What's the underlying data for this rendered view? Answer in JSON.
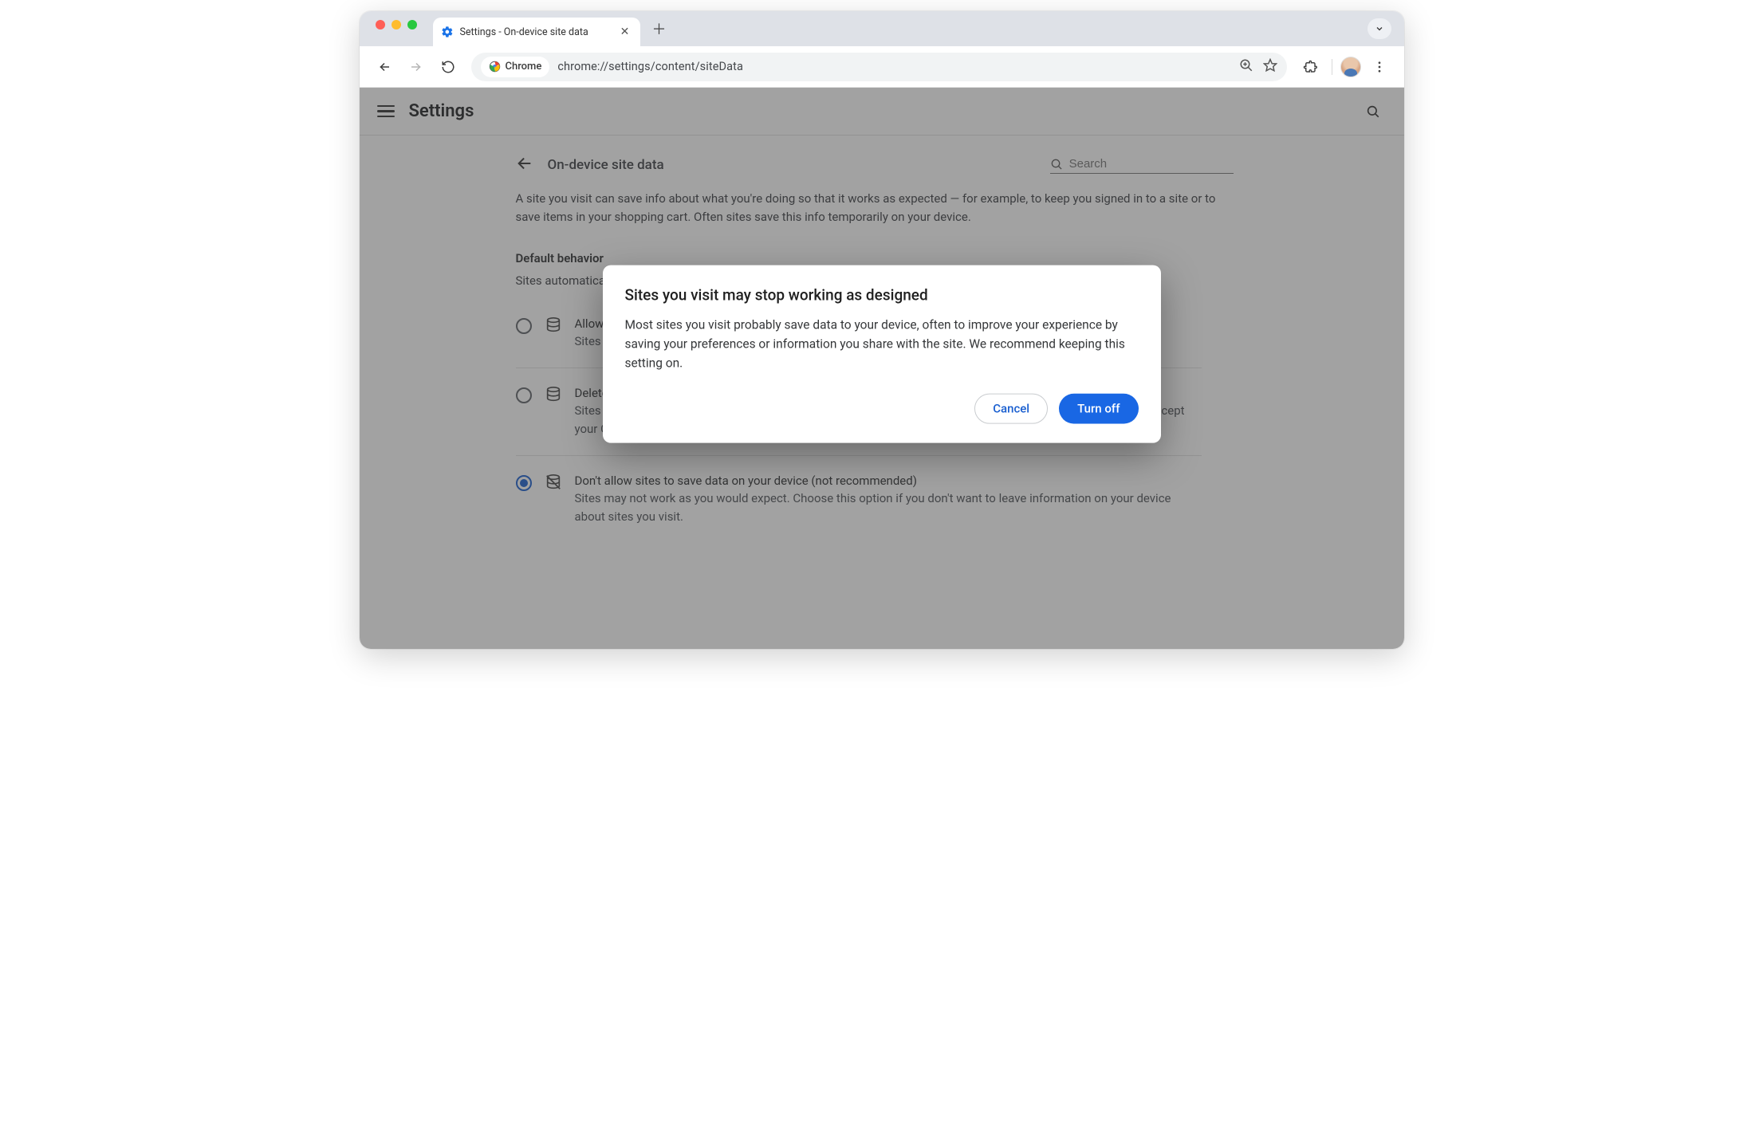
{
  "browser": {
    "tab_title": "Settings - On-device site data",
    "omnibox_chip": "Chrome",
    "url": "chrome://settings/content/siteData"
  },
  "header": {
    "title": "Settings"
  },
  "section": {
    "title": "On-device site data",
    "search_placeholder": "Search",
    "description": "A site you visit can save info about what you're doing so that it works as expected — for example, to keep you signed in to a site or to save items in your shopping cart. Often sites save this info temporarily on your device.",
    "default_heading": "Default behavior",
    "default_sub": "Sites automatically follow this setting when you visit them"
  },
  "options": [
    {
      "title": "Allow sites to save data on your device",
      "subtitle": "Sites will probably work as expected.",
      "selected": false,
      "strike": false
    },
    {
      "title": "Delete data sites have saved to your device when you close all windows",
      "subtitle": "Sites will probably work as expected. You'll be signed out of most sites when you close all Chrome windows, except your Google Account if you're signed in to Chrome.",
      "selected": false,
      "strike": false
    },
    {
      "title": "Don't allow sites to save data on your device (not recommended)",
      "subtitle": "Sites may not work as you would expect. Choose this option if you don't want to leave information on your device about sites you visit.",
      "selected": true,
      "strike": true
    }
  ],
  "dialog": {
    "title": "Sites you visit may stop working as designed",
    "body": "Most sites you visit probably save data to your device, often to improve your experience by saving your preferences or information you share with the site. We recommend keeping this setting on.",
    "cancel": "Cancel",
    "confirm": "Turn off"
  }
}
